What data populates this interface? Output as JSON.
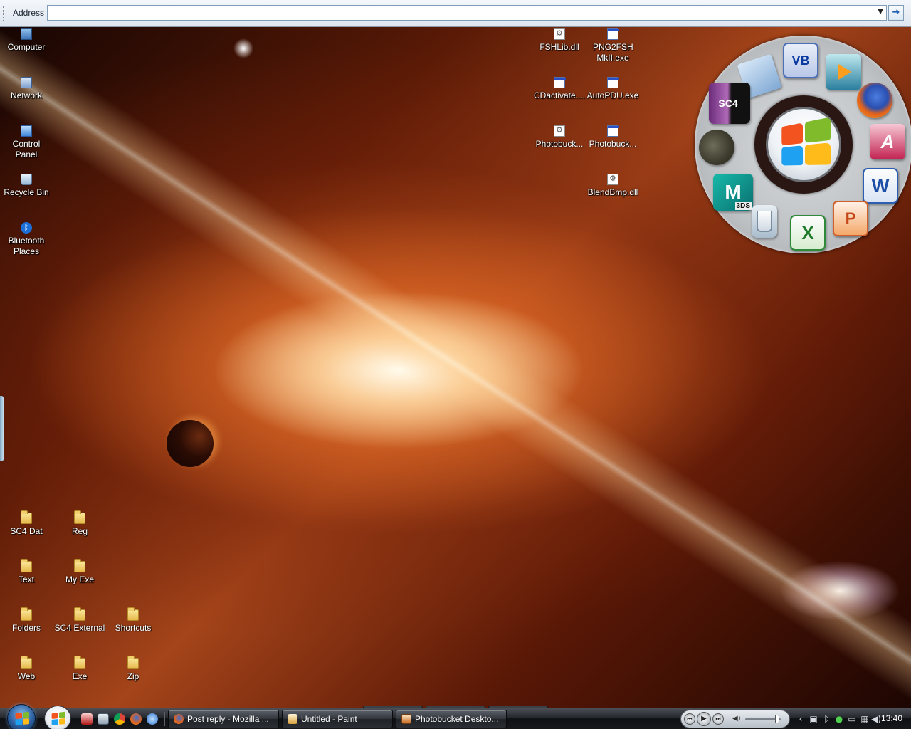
{
  "address_bar": {
    "label": "Address",
    "value": "",
    "dropdown_glyph": "▼",
    "go_glyph": "➔"
  },
  "desktop": {
    "system_icons": [
      {
        "label": "Computer",
        "icon": "computer-icon"
      },
      {
        "label": "Network",
        "icon": "network-icon"
      },
      {
        "label": "Control Panel",
        "icon": "control-panel-icon"
      },
      {
        "label": "Recycle Bin",
        "icon": "recycle-bin-icon"
      },
      {
        "label": "Bluetooth Places",
        "icon": "bluetooth-icon"
      }
    ],
    "file_icons": [
      {
        "label": "FSHLib.dll",
        "icon": "dll-file-icon"
      },
      {
        "label": "PNG2FSH MkII.exe",
        "icon": "exe-file-icon"
      },
      {
        "label": "CDactivate....",
        "icon": "exe-file-icon"
      },
      {
        "label": "AutoPDU.exe",
        "icon": "exe-file-icon"
      },
      {
        "label": "Photobuck...",
        "icon": "dll-file-icon"
      },
      {
        "label": "Photobuck...",
        "icon": "exe-file-icon"
      },
      {
        "label": "BlendBmp.dll",
        "icon": "dll-file-icon"
      }
    ],
    "folders": [
      {
        "label": "SC4 Dat"
      },
      {
        "label": "Reg"
      },
      {
        "label": "Text"
      },
      {
        "label": "My Exe"
      },
      {
        "label": "Folders"
      },
      {
        "label": "SC4 External"
      },
      {
        "label": "Shortcuts"
      },
      {
        "label": "Web"
      },
      {
        "label": "Exe"
      },
      {
        "label": "Zip"
      }
    ]
  },
  "launcher": {
    "apps": [
      {
        "name": "folder",
        "icon": "folder-icon",
        "text": ""
      },
      {
        "name": "visual-basic",
        "icon": "visual-basic-icon",
        "text": "VB"
      },
      {
        "name": "media-player",
        "icon": "media-player-icon",
        "text": ""
      },
      {
        "name": "firefox",
        "icon": "firefox-icon",
        "text": ""
      },
      {
        "name": "simcity-4",
        "icon": "simcity-4-icon",
        "text": "SC4"
      },
      {
        "name": "access",
        "icon": "access-icon",
        "text": "A"
      },
      {
        "name": "gimp",
        "icon": "gimp-icon",
        "text": ""
      },
      {
        "name": "word",
        "icon": "word-icon",
        "text": "W"
      },
      {
        "name": "3ds-max",
        "icon": "3ds-max-icon",
        "text": "M",
        "tag": "3DS"
      },
      {
        "name": "paint-brushes",
        "icon": "paint-brushes-icon",
        "text": ""
      },
      {
        "name": "excel",
        "icon": "excel-icon",
        "text": "X"
      },
      {
        "name": "powerpoint",
        "icon": "powerpoint-icon",
        "text": "P"
      }
    ]
  },
  "taskbar": {
    "tasks": [
      {
        "label": "Post reply - Mozilla ...",
        "icon": "firefox-icon"
      },
      {
        "label": "Untitled - Paint",
        "icon": "paint-icon"
      },
      {
        "label": "Photobucket Deskto...",
        "icon": "photobucket-icon"
      }
    ],
    "clock": "13:40"
  },
  "colors": {
    "taskbar_bg": "#16181c",
    "address_bar_bg": "#e8edf3",
    "wallpaper_glow": "#ffd6a0"
  }
}
